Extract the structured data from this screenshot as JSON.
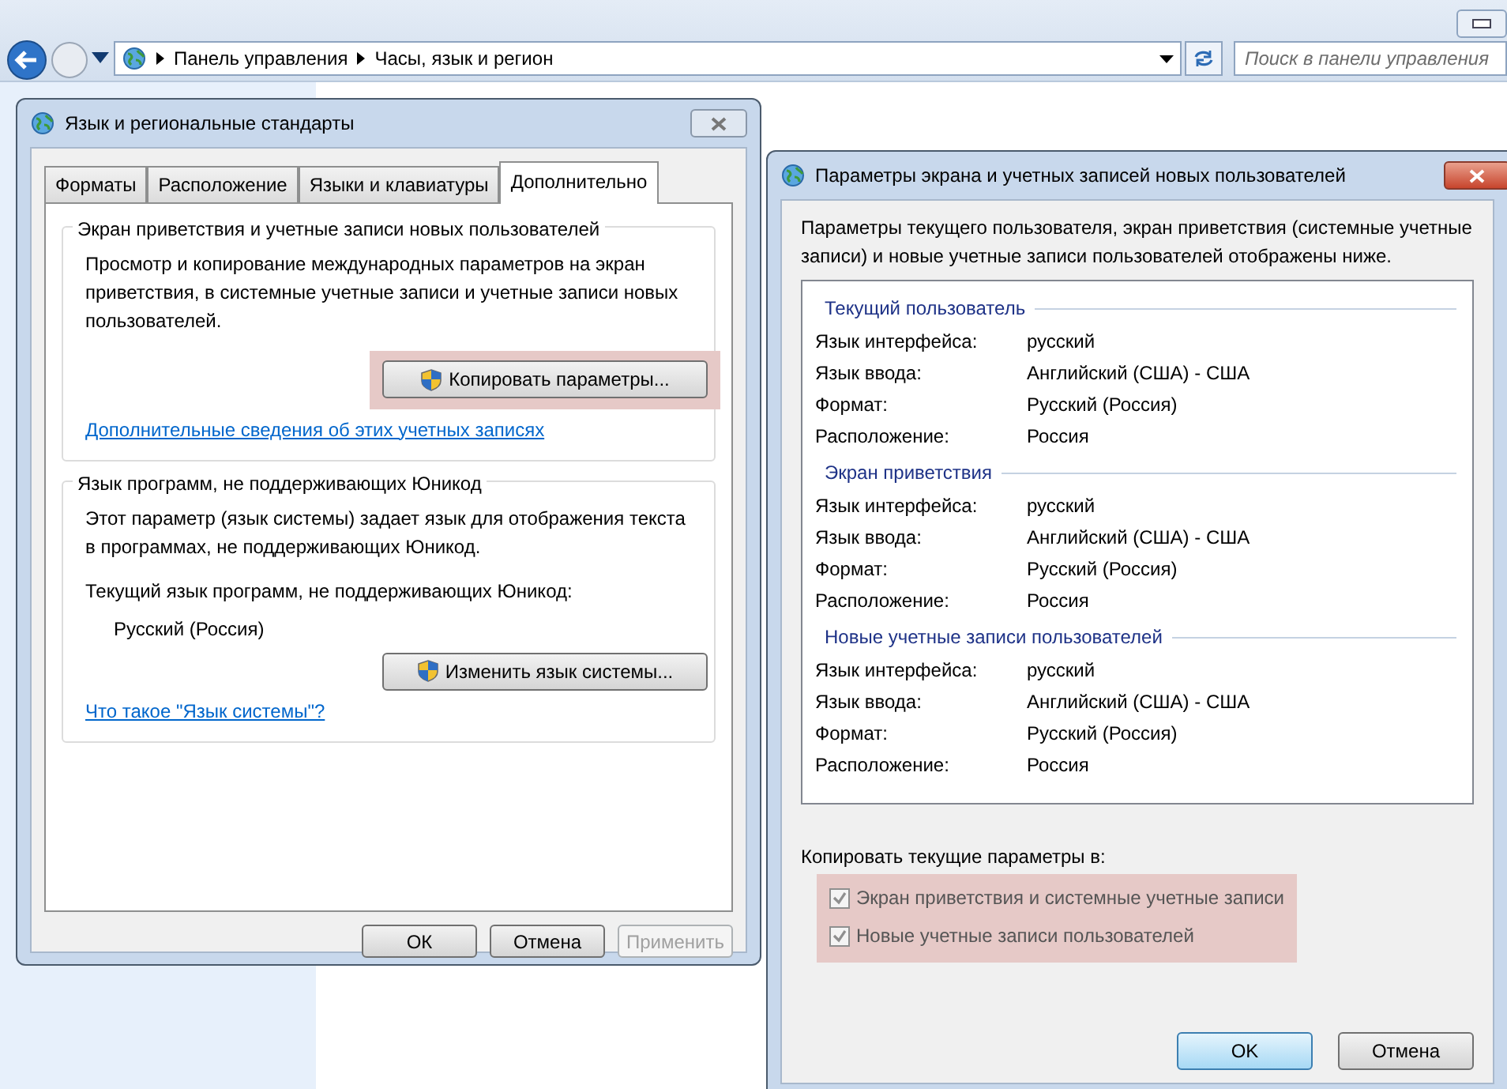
{
  "explorer": {
    "breadcrumbs": [
      "Панель управления",
      "Часы, язык и регион"
    ],
    "search": {
      "placeholder": "Поиск в панели управления"
    }
  },
  "regional_dialog": {
    "title": "Язык и региональные стандарты",
    "tabs": [
      {
        "label": "Форматы",
        "selected": false
      },
      {
        "label": "Расположение",
        "selected": false
      },
      {
        "label": "Языки и клавиатуры",
        "selected": false
      },
      {
        "label": "Дополнительно",
        "selected": true
      }
    ],
    "groups": [
      {
        "title": "Экран приветствия и учетные записи новых пользователей",
        "items": [
          {
            "kind": "text",
            "text": "Просмотр и копирование международных параметров на экран приветствия, в системные учетные записи и учетные записи новых пользователей."
          },
          {
            "kind": "button",
            "label": "Копировать параметры...",
            "highlighted": true
          },
          {
            "kind": "link",
            "text": "Дополнительные сведения об этих учетных записях"
          }
        ]
      },
      {
        "title": "Язык программ, не поддерживающих Юникод",
        "items": [
          {
            "kind": "text",
            "text": "Этот параметр (язык системы) задает язык для отображения текста в программах, не поддерживающих Юникод."
          },
          {
            "kind": "text",
            "text": "Текущий язык программ, не поддерживающих Юникод:"
          },
          {
            "kind": "value",
            "text": "Русский (Россия)"
          },
          {
            "kind": "button",
            "label": "Изменить язык системы...",
            "highlighted": false
          },
          {
            "kind": "link",
            "text": "Что такое \"Язык системы\"?"
          }
        ]
      }
    ],
    "buttons": [
      {
        "label": "ОК",
        "disabled": false
      },
      {
        "label": "Отмена",
        "disabled": false
      },
      {
        "label": "Применить",
        "disabled": true
      }
    ]
  },
  "copy_dialog": {
    "title": "Параметры экрана и учетных записей новых пользователей",
    "description": "Параметры текущего пользователя, экран приветствия (системные учетные записи) и новые учетные записи пользователей отображены ниже.",
    "sections": [
      {
        "title": "Текущий пользователь",
        "rows": [
          {
            "label": "Язык интерфейса:",
            "value": "русский"
          },
          {
            "label": "Язык ввода:",
            "value": "Английский (США) - США"
          },
          {
            "label": "Формат:",
            "value": "Русский (Россия)"
          },
          {
            "label": "Расположение:",
            "value": "Россия"
          }
        ]
      },
      {
        "title": "Экран приветствия",
        "rows": [
          {
            "label": "Язык интерфейса:",
            "value": "русский"
          },
          {
            "label": "Язык ввода:",
            "value": "Английский (США) - США"
          },
          {
            "label": "Формат:",
            "value": "Русский (Россия)"
          },
          {
            "label": "Расположение:",
            "value": "Россия"
          }
        ]
      },
      {
        "title": "Новые учетные записи пользователей",
        "rows": [
          {
            "label": "Язык интерфейса:",
            "value": "русский"
          },
          {
            "label": "Язык ввода:",
            "value": "Английский (США) - США"
          },
          {
            "label": "Формат:",
            "value": "Русский (Россия)"
          },
          {
            "label": "Расположение:",
            "value": "Россия"
          }
        ]
      }
    ],
    "copy_label": "Копировать текущие параметры в:",
    "options_highlighted": true,
    "options": [
      {
        "label": "Экран приветствия и системные учетные записи",
        "checked": true,
        "disabled": true
      },
      {
        "label": "Новые учетные записи пользователей",
        "checked": true,
        "disabled": true
      }
    ],
    "buttons": [
      {
        "label": "OK",
        "default": true
      },
      {
        "label": "Отмена",
        "default": false
      }
    ]
  }
}
